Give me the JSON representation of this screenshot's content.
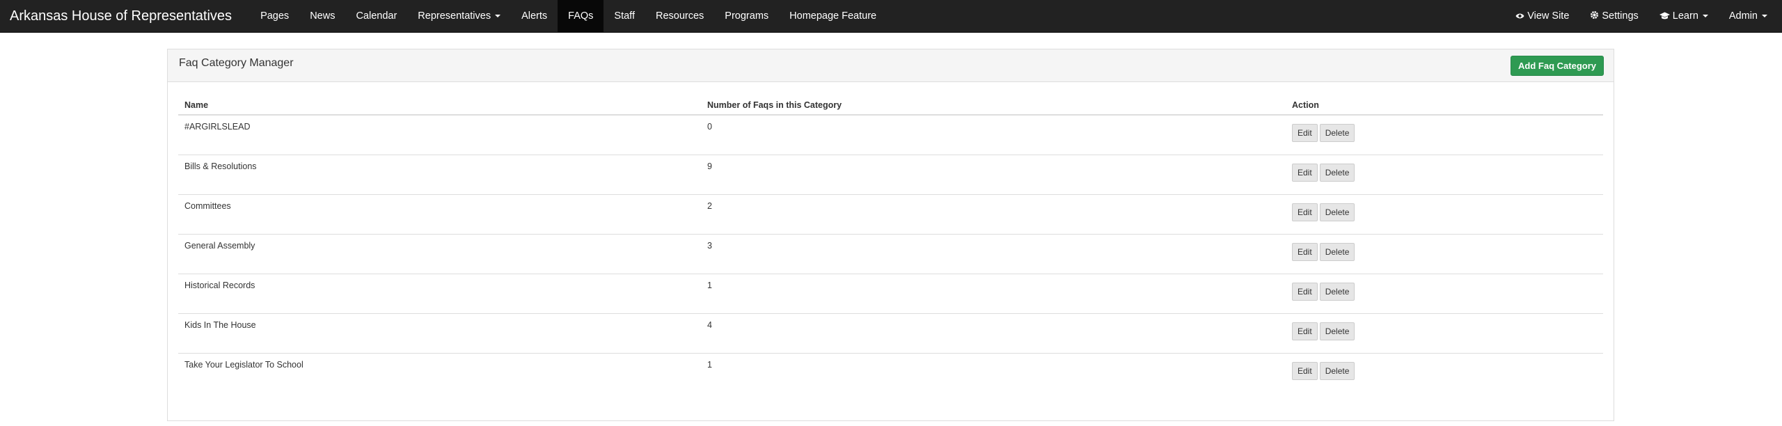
{
  "navbar": {
    "brand": "Arkansas House of Representatives",
    "left_items": [
      {
        "label": "Pages",
        "name": "nav-pages"
      },
      {
        "label": "News",
        "name": "nav-news"
      },
      {
        "label": "Calendar",
        "name": "nav-calendar"
      },
      {
        "label": "Representatives",
        "name": "nav-representatives"
      },
      {
        "label": "Alerts",
        "name": "nav-alerts"
      },
      {
        "label": "FAQs",
        "name": "nav-faqs"
      },
      {
        "label": "Staff",
        "name": "nav-staff"
      },
      {
        "label": "Resources",
        "name": "nav-resources"
      },
      {
        "label": "Programs",
        "name": "nav-programs"
      },
      {
        "label": "Homepage Feature",
        "name": "nav-homepage-feature"
      }
    ],
    "right_items": {
      "view_site": "View Site",
      "settings": "Settings",
      "learn": "Learn",
      "admin": "Admin"
    }
  },
  "panel": {
    "title": "Faq Category Manager",
    "add_button": "Add Faq Category",
    "columns": [
      "Name",
      "Number of Faqs in this Category",
      "Action"
    ],
    "edit_label": "Edit",
    "delete_label": "Delete",
    "rows": [
      {
        "name": "#ARGIRLSLEAD",
        "count": "0"
      },
      {
        "name": "Bills & Resolutions",
        "count": "9"
      },
      {
        "name": "Committees",
        "count": "2"
      },
      {
        "name": "General Assembly",
        "count": "3"
      },
      {
        "name": "Historical Records",
        "count": "1"
      },
      {
        "name": "Kids In The House",
        "count": "4"
      },
      {
        "name": "Take Your Legislator To School",
        "count": "1"
      }
    ]
  }
}
